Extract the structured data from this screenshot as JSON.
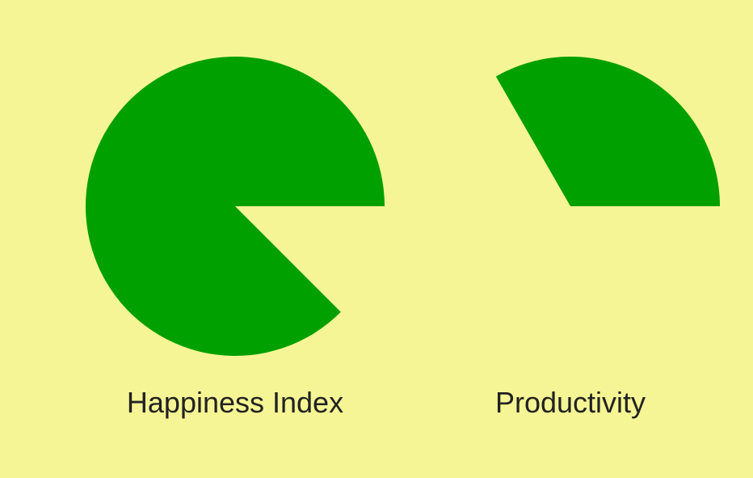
{
  "colors": {
    "background": "#f6f595",
    "wedge": "#00a000",
    "label": "#222222"
  },
  "chart_data": {
    "type": "pie",
    "title": "",
    "grid": false,
    "legend": "none",
    "charts": [
      {
        "label": "Happiness Index",
        "fill_percent": 87.5,
        "start_angle_deg": 0,
        "direction": "counterclockwise"
      },
      {
        "label": "Productivity",
        "fill_percent": 33.3,
        "start_angle_deg": 0,
        "direction": "counterclockwise"
      }
    ]
  }
}
